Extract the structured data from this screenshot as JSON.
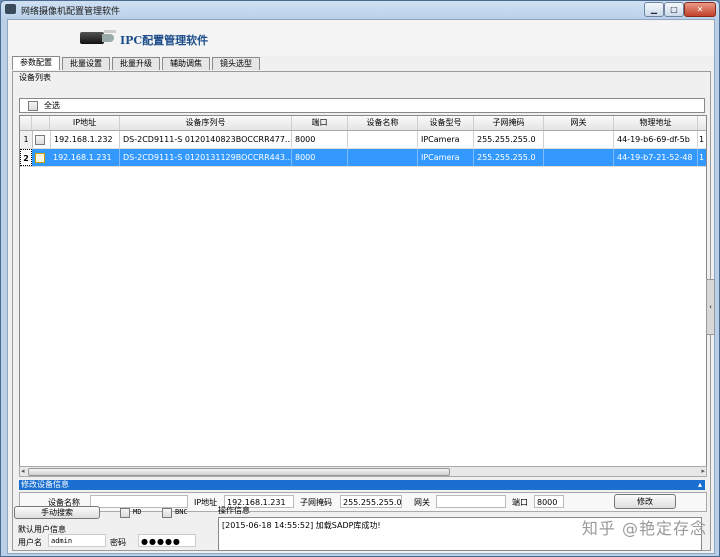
{
  "window": {
    "title": "网络摄像机配置管理软件",
    "banner_title": "IPC配置管理软件"
  },
  "tabs": [
    "参数配置",
    "批量设置",
    "批量升级",
    "辅助调焦",
    "镜头选型"
  ],
  "device_list": {
    "label": "设备列表",
    "select_all": "全选",
    "columns": [
      "IP地址",
      "设备序列号",
      "端口",
      "设备名称",
      "设备型号",
      "子网掩码",
      "网关",
      "物理地址"
    ],
    "rows": [
      {
        "num": "1",
        "ip": "192.168.1.232",
        "serial": "DS-2CD9111-S 0120140823BOCCRR477...",
        "port": "8000",
        "name": "",
        "model": "IPCamera",
        "mask": "255.255.255.0",
        "gateway": "",
        "mac": "44-19-b6-69-df-5b",
        "extra": "1",
        "selected": false
      },
      {
        "num": "2",
        "ip": "192.168.1.231",
        "serial": "DS-2CD9111-S 0120131129BOCCRR443...",
        "port": "8000",
        "name": "",
        "model": "IPCamera",
        "mask": "255.255.255.0",
        "gateway": "",
        "mac": "44-19-b7-21-52-48",
        "extra": "1",
        "selected": true
      }
    ]
  },
  "modify": {
    "title": "修改设备信息",
    "name_label": "设备名称",
    "name_value": "",
    "ip_label": "IP地址",
    "ip_value": "192.168.1.231",
    "mask_label": "子网掩码",
    "mask_value": "255.255.255.0",
    "gw_label": "网关",
    "gw_value": "",
    "port_label": "端口",
    "port_value": "8000",
    "modify_button": "修改"
  },
  "bottom": {
    "manual_search": "手动搜索",
    "md_label": "MD",
    "bnc_label": "BNC",
    "default_user_label": "默认用户信息",
    "user_label": "用户名",
    "user_value": "admin",
    "pwd_label": "密码",
    "pwd_value": "●●●●●",
    "oplog_title": "操作信息",
    "oplog_text": "[2015-06-18 14:55:52] 加载SADP库成功!"
  },
  "watermark": "知乎 @艳定存念",
  "colors": {
    "selection": "#3399ff",
    "modify_bar": "#1a6fd0",
    "banner_title": "#1d4e8a"
  }
}
